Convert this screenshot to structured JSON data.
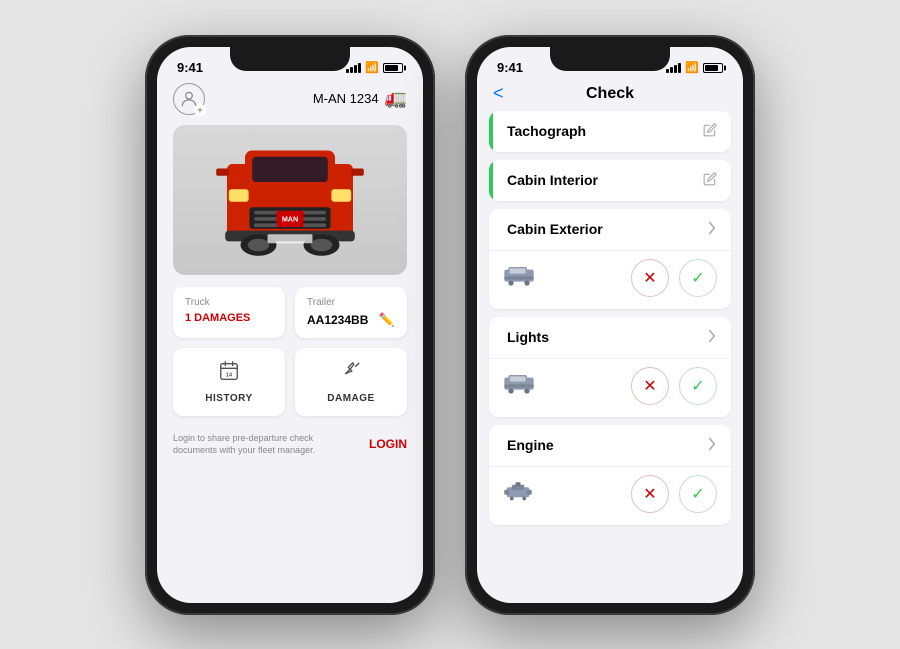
{
  "background_color": "#e5e5e5",
  "phone1": {
    "status_bar": {
      "time": "9:41",
      "signal": "●●●",
      "wifi": "WiFi",
      "battery": "Battery"
    },
    "header": {
      "vehicle_id": "M-AN 1234"
    },
    "truck_section": {
      "label": "Truck",
      "damages": "1 DAMAGES"
    },
    "trailer_section": {
      "label": "Trailer",
      "value": "AA1234BB"
    },
    "action_history": {
      "icon": "📅",
      "label": "HISTORY"
    },
    "action_damage": {
      "icon": "🔧",
      "label": "DAMAGE"
    },
    "login_text": "Login to share pre-departure check documents with your fleet manager.",
    "login_btn": "LOGIN"
  },
  "phone2": {
    "status_bar": {
      "time": "9:41"
    },
    "back_label": "<",
    "title": "Check",
    "sections": [
      {
        "title": "Tachograph",
        "has_green_border": true,
        "icon_type": "pencil",
        "has_sub_row": false
      },
      {
        "title": "Cabin Interior",
        "has_green_border": true,
        "icon_type": "pencil",
        "has_sub_row": false
      },
      {
        "title": "Cabin Exterior",
        "has_green_border": false,
        "icon_type": "chevron",
        "has_sub_row": true
      },
      {
        "title": "Lights",
        "has_green_border": false,
        "icon_type": "chevron",
        "has_sub_row": true
      },
      {
        "title": "Engine",
        "has_green_border": false,
        "icon_type": "chevron",
        "has_sub_row": true
      }
    ]
  }
}
